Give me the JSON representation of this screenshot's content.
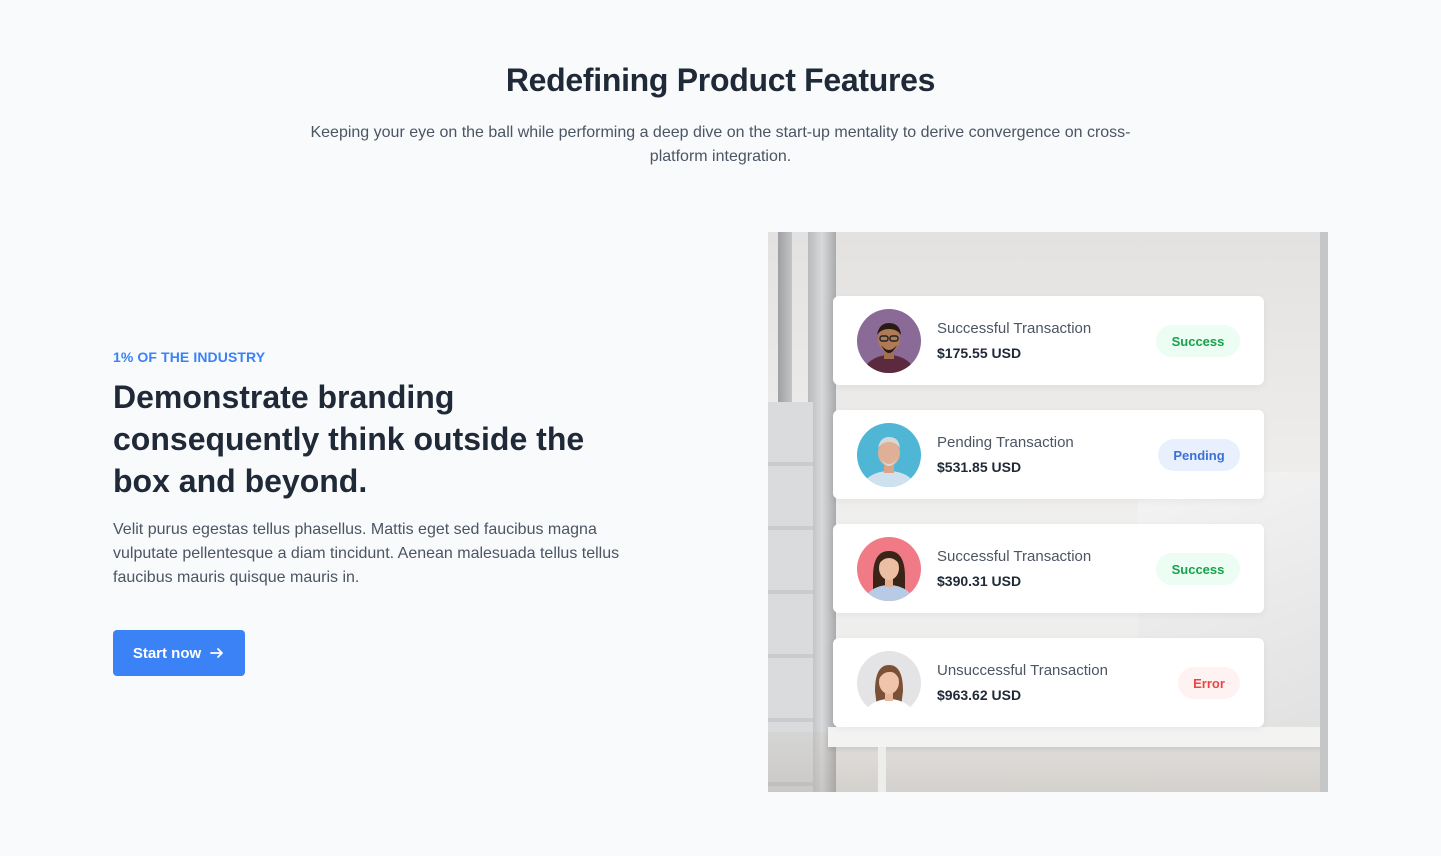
{
  "header": {
    "title": "Redefining Product Features",
    "subtitle": "Keeping your eye on the ball while performing a deep dive on the start-up mentality to  derive convergence on cross-platform integration."
  },
  "feature": {
    "eyebrow": "1% OF THE INDUSTRY",
    "headline": "Demonstrate branding consequently think outside the box and beyond.",
    "body": "Velit purus egestas tellus phasellus. Mattis eget sed faucibus magna vulputate pellentesque a diam tincidunt. Aenean malesuada tellus tellus faucibus mauris quisque mauris in.",
    "cta_label": "Start now",
    "cta_icon": "arrow-right-icon"
  },
  "transactions": [
    {
      "title": "Successful Transaction",
      "amount": "$175.55 USD",
      "status": "Success",
      "status_type": "success"
    },
    {
      "title": "Pending Transaction",
      "amount": "$531.85 USD",
      "status": "Pending",
      "status_type": "pending"
    },
    {
      "title": "Successful Transaction",
      "amount": "$390.31 USD",
      "status": "Success",
      "status_type": "success"
    },
    {
      "title": "Unsuccessful Transaction",
      "amount": "$963.62 USD",
      "status": "Error",
      "status_type": "error"
    }
  ],
  "colors": {
    "accent": "#3b82f6",
    "success": "#16a34a",
    "pending": "#3b6fd9",
    "error": "#ef4444",
    "background": "#f8fafc"
  }
}
